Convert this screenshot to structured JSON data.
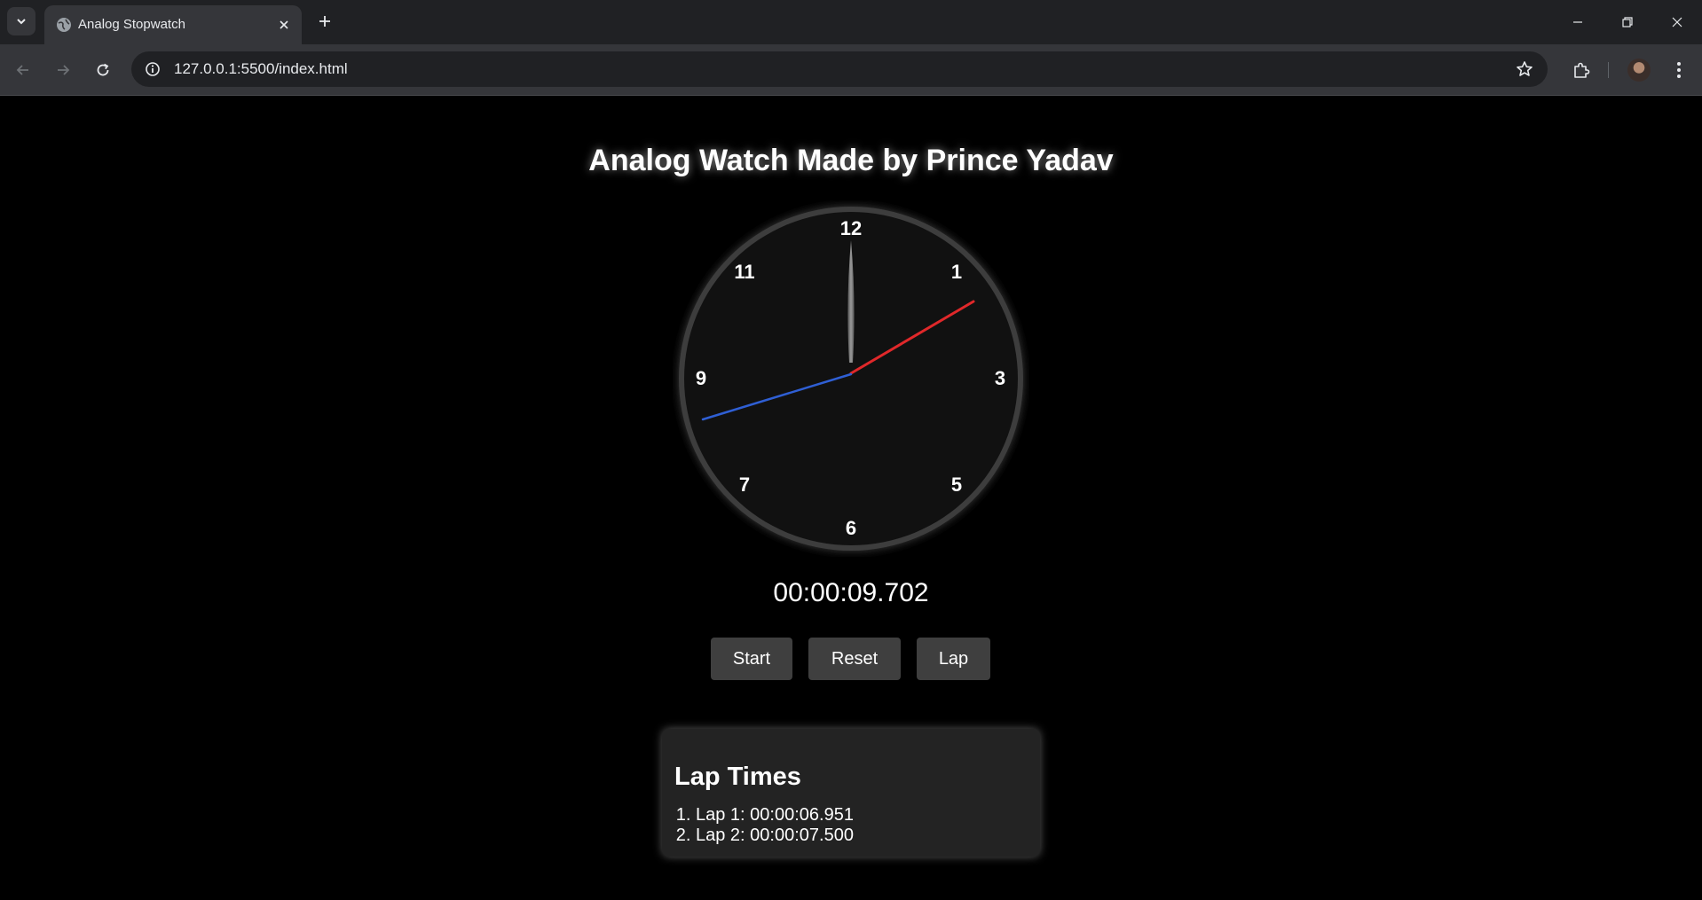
{
  "browser": {
    "tab_title": "Analog Stopwatch",
    "url": "127.0.0.1:5500/index.html",
    "icons": {
      "tab_list": "chevron-down-icon",
      "favicon": "globe-icon",
      "tab_close": "close-icon",
      "new_tab": "plus-icon",
      "minimize": "minimize-icon",
      "restore": "restore-icon",
      "close_window": "close-icon",
      "back": "arrow-left-icon",
      "forward": "arrow-right-icon",
      "reload": "reload-icon",
      "site_info": "info-icon",
      "bookmark": "star-icon",
      "extensions": "puzzle-icon",
      "menu": "kebab-menu-icon"
    }
  },
  "page": {
    "title": "Analog Watch Made by Prince Yadav",
    "clock": {
      "numbers": [
        "12",
        "1",
        "3",
        "5",
        "6",
        "7",
        "9",
        "11"
      ],
      "hand_colors": {
        "minute": "#8a8a8a",
        "second": "#e0282a",
        "millisecond": "#2f5fd4"
      },
      "face_color": "#111111",
      "rim_color": "#3d3d3d"
    },
    "display_time": "00:00:09.702",
    "buttons": {
      "start": "Start",
      "reset": "Reset",
      "lap": "Lap"
    },
    "laps": {
      "heading": "Lap Times",
      "items": [
        "Lap 1: 00:00:06.951",
        "Lap 2: 00:00:07.500"
      ]
    }
  }
}
